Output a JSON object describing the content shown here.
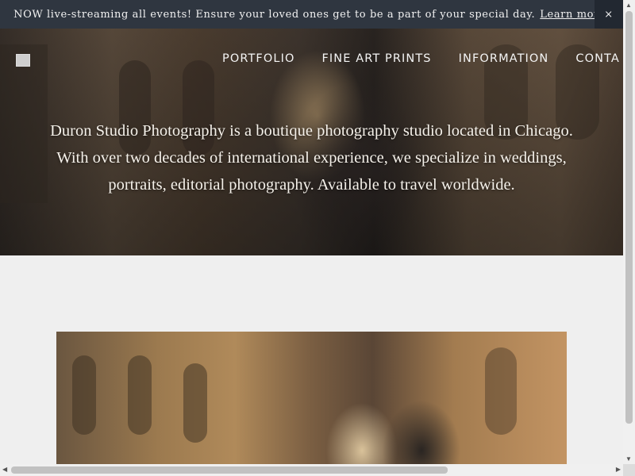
{
  "announcement": {
    "text": "NOW live-streaming all events! Ensure your loved ones get to be a part of your special day.",
    "link": "Learn more.",
    "close": "×"
  },
  "nav": {
    "items": [
      "PORTFOLIO",
      "FINE ART PRINTS",
      "INFORMATION",
      "CONTA"
    ]
  },
  "hero": {
    "lines": [
      "Duron Studio Photography is a boutique photography studio located in Chicago.",
      "With over two decades of international experience, we specialize in weddings,",
      "portraits, editorial photography. Available to travel worldwide."
    ]
  },
  "scrollbars": {
    "up": "▲",
    "down": "▼",
    "left": "◀",
    "right": "▶"
  }
}
